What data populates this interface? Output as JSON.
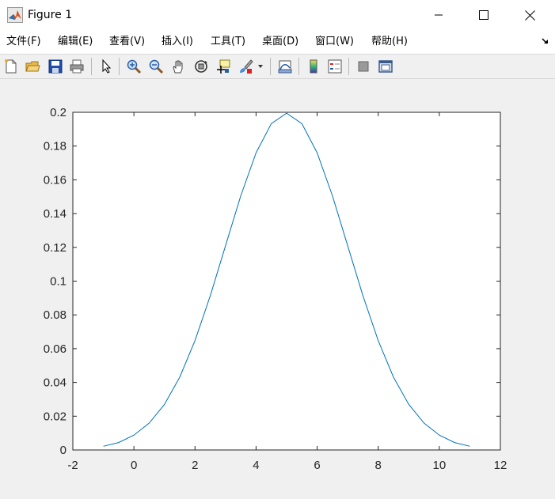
{
  "window": {
    "title": "Figure 1",
    "minimize_icon": "minimize-icon",
    "maximize_icon": "maximize-icon",
    "close_icon": "close-icon"
  },
  "menu": {
    "items": [
      "文件(F)",
      "编辑(E)",
      "查看(V)",
      "插入(I)",
      "工具(T)",
      "桌面(D)",
      "窗口(W)",
      "帮助(H)"
    ]
  },
  "toolbar": {
    "buttons": [
      "new-figure-icon",
      "open-file-icon",
      "save-icon",
      "print-icon",
      "edit-plot-pointer-icon",
      "zoom-in-icon",
      "zoom-out-icon",
      "pan-hand-icon",
      "rotate-3d-icon",
      "data-cursor-icon",
      "brush-icon",
      "brush-dropdown-icon",
      "link-plot-icon",
      "colorbar-icon",
      "legend-icon",
      "hide-plot-tools-icon",
      "show-plot-tools-icon"
    ]
  },
  "colors": {
    "line": "#0072bd",
    "axes_bg": "#ffffff",
    "figure_bg": "#f0f0f0"
  },
  "chart_data": {
    "type": "line",
    "title": "",
    "xlabel": "",
    "ylabel": "",
    "xlim": [
      -2,
      12
    ],
    "ylim": [
      0,
      0.2
    ],
    "xticks": [
      "-2",
      "0",
      "2",
      "4",
      "6",
      "8",
      "10",
      "12"
    ],
    "yticks": [
      "0",
      "0.02",
      "0.04",
      "0.06",
      "0.08",
      "0.1",
      "0.12",
      "0.14",
      "0.16",
      "0.18",
      "0.2"
    ],
    "grid": false,
    "x": [
      -1,
      -0.5,
      0,
      0.5,
      1,
      1.5,
      2,
      2.5,
      3,
      3.5,
      4,
      4.5,
      5,
      5.5,
      6,
      6.5,
      7,
      7.5,
      8,
      8.5,
      9,
      9.5,
      10,
      10.5,
      11
    ],
    "y": [
      0.0022,
      0.0044,
      0.0088,
      0.0159,
      0.027,
      0.0431,
      0.0648,
      0.0913,
      0.121,
      0.1506,
      0.176,
      0.1933,
      0.1995,
      0.1933,
      0.176,
      0.1506,
      0.121,
      0.0913,
      0.0648,
      0.0431,
      0.027,
      0.0159,
      0.0088,
      0.0044,
      0.0022
    ]
  }
}
